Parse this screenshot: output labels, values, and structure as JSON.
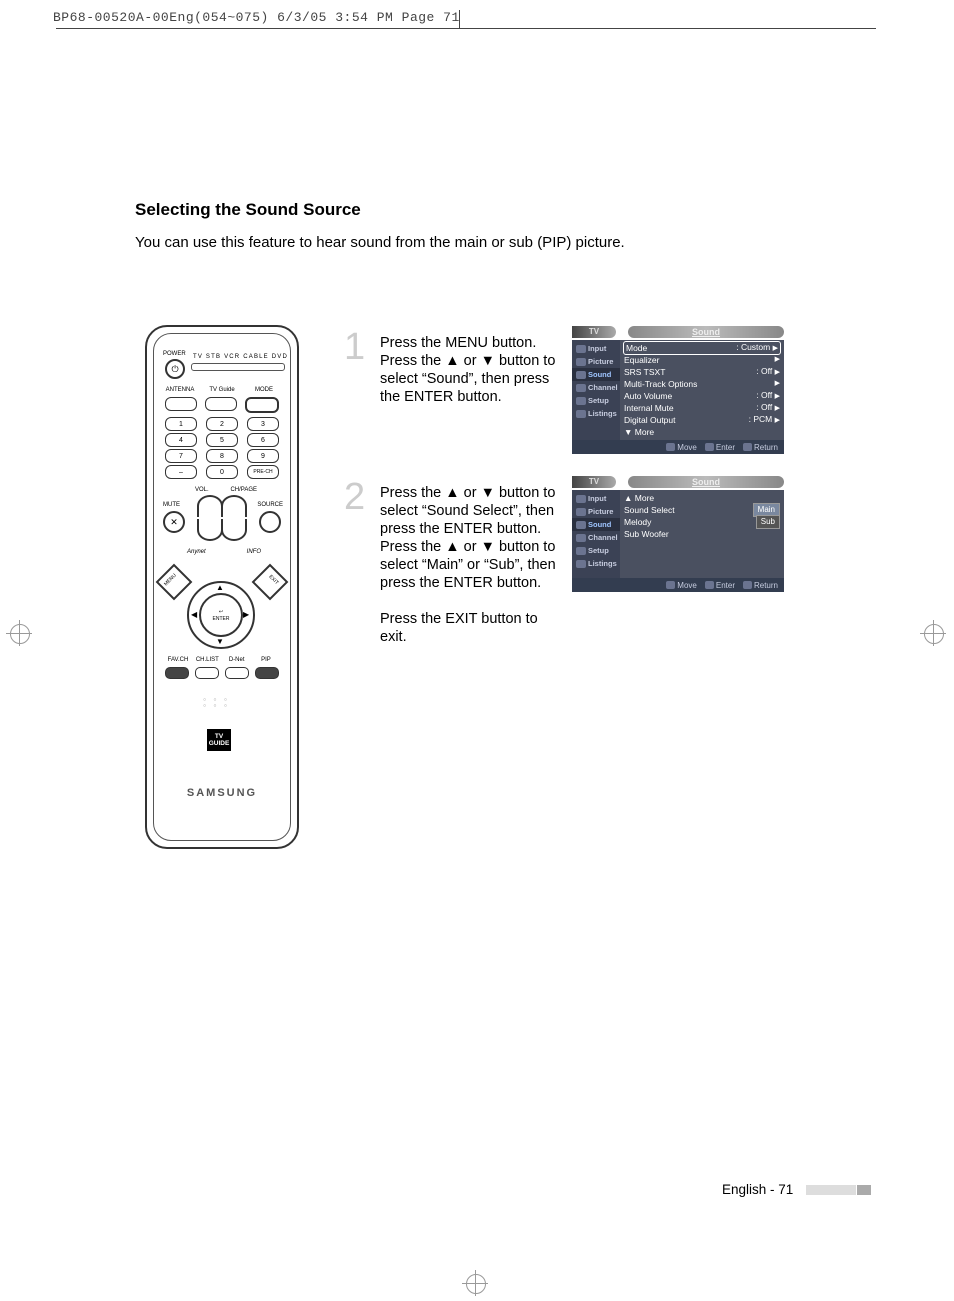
{
  "header": "BP68-00520A-00Eng(054~075)  6/3/05  3:54 PM  Page 71",
  "title": "Selecting the Sound Source",
  "intro": "You can use this feature to hear sound from the main or sub (PIP) picture.",
  "remote": {
    "power_label": "POWER",
    "mode_labels": "TV  STB  VCR  CABLE  DVD",
    "row_labels": {
      "antenna": "ANTENNA",
      "tvguide": "TV Guide",
      "mode": "MODE"
    },
    "numpad": {
      "1": "1",
      "2": "2",
      "3": "3",
      "4": "4",
      "5": "5",
      "6": "6",
      "7": "7",
      "8": "8",
      "9": "9",
      "dash": "–",
      "0": "0",
      "prech": "PRE-CH"
    },
    "vol": "VOL.",
    "ch": "CH/PAGE",
    "mute": "MUTE",
    "source": "SOURCE",
    "anynet": "Anynet",
    "info": "INFO",
    "menu": "MENU",
    "exit": "EXIT",
    "enter_icon": "↩",
    "enter": "ENTER",
    "bottom_labels": {
      "a": "FAV.CH",
      "b": "CH.LIST",
      "c": "D-Net",
      "d": "PIP"
    },
    "tvguide_top": "TV",
    "tvguide_bottom": "GUIDE",
    "brand": "SAMSUNG"
  },
  "steps": {
    "s1": {
      "num": "1",
      "text": "Press the MENU button.\nPress the ▲ or ▼ button to select “Sound”, then press the ENTER button."
    },
    "s2": {
      "num": "2",
      "text": "Press the ▲ or ▼ button to select “Sound Select”, then press the ENTER button.\nPress the ▲ or ▼ button to select “Main” or “Sub”, then press the ENTER button.\n\nPress the EXIT button to exit."
    }
  },
  "osd": {
    "tv": "TV",
    "title": "Sound",
    "side": {
      "input": "Input",
      "picture": "Picture",
      "sound": "Sound",
      "channel": "Channel",
      "setup": "Setup",
      "listings": "Listings"
    },
    "foot": {
      "move": "Move",
      "enter": "Enter",
      "return": "Return"
    },
    "menu1": {
      "mode": {
        "l": "Mode",
        "v": ": Custom"
      },
      "eq": "Equalizer",
      "srs": {
        "l": "SRS TSXT",
        "v": ": Off"
      },
      "mto": "Multi-Track Options",
      "av": {
        "l": "Auto Volume",
        "v": ": Off"
      },
      "im": {
        "l": "Internal Mute",
        "v": ": Off"
      },
      "do": {
        "l": "Digital Output",
        "v": ": PCM"
      },
      "more": "▼ More"
    },
    "menu2": {
      "more": "▲ More",
      "ss": {
        "l": "Sound Select",
        "main": "Main",
        "sub": "Sub"
      },
      "melody": "Melody",
      "sw": "Sub Woofer"
    }
  },
  "footer": "English - 71"
}
